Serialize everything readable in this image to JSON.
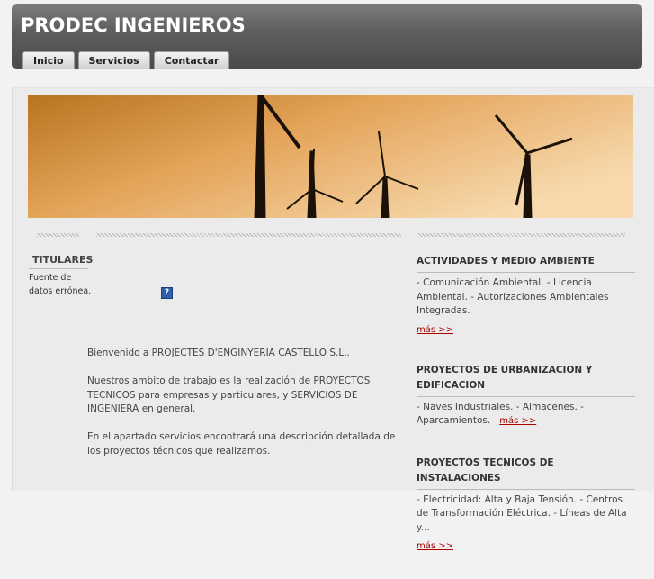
{
  "header": {
    "title": "PRODEC INGENIEROS",
    "nav": [
      "Inicio",
      "Servicios",
      "Contactar"
    ]
  },
  "banner": {
    "description_icon": "wind-turbines-image"
  },
  "sidebar": {
    "heading": "TITULARES",
    "text": "Fuente de datos errónea."
  },
  "main": {
    "help_icon": "?",
    "paragraphs": [
      "Bienvenido a PROJECTES D'ENGINYERIA CASTELLO S.L..",
      "Nuestros ambito de trabajo es la realización de PROYECTOS TECNICOS para empresas y particulares, y SERVICIOS DE INGENIERA en general.",
      "En el apartado servicios encontrará una descripción detallada de los proyectos técnicos que realizamos."
    ]
  },
  "right": {
    "sections": [
      {
        "title": "ACTIVIDADES Y MEDIO AMBIENTE",
        "body": "- Comunicación Ambiental. - Licencia Ambiental. - Autorizaciones Ambientales Integradas.",
        "more": "más >>"
      },
      {
        "title": "PROYECTOS DE URBANIZACION Y EDIFICACION",
        "body": "- Naves Industriales. - Almacenes. - Aparcamientos.",
        "more": "más >>"
      },
      {
        "title": "PROYECTOS TECNICOS DE INSTALACIONES",
        "body": "- Electricidad: Alta y Baja Tensión. - Centros de Transformación Eléctrica. - Líneas de Alta y...",
        "more": "más >>"
      }
    ]
  },
  "colors": {
    "header_bg": "#5f5f5f",
    "link": "#aa0000",
    "sky": "#e8a04a"
  }
}
